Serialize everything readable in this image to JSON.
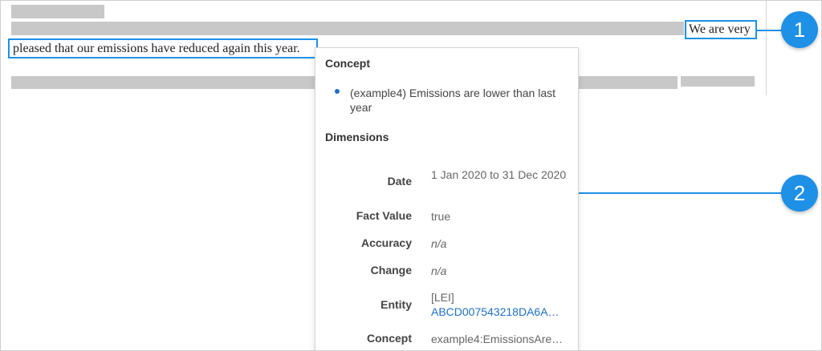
{
  "document": {
    "line1_text": "We are very",
    "line2_text": "pleased that our emissions have reduced again this year."
  },
  "callouts": {
    "one": "1",
    "two": "2"
  },
  "popup": {
    "concept_heading": "Concept",
    "concept_item": "(example4) Emissions are lower than last year",
    "dimensions_heading": "Dimensions",
    "rows": [
      {
        "label": "Date",
        "value": "1 Jan 2020 to 31 Dec 2020"
      },
      {
        "label": "Fact Value",
        "value": "true"
      },
      {
        "label": "Accuracy",
        "value": "n/a"
      },
      {
        "label": "Change",
        "value": "n/a"
      },
      {
        "label": "Entity",
        "value_prefix": "[LEI]",
        "value_link": "ABCD007543218DA6A…"
      },
      {
        "label": "Concept",
        "value": "example4:EmissionsAre…"
      }
    ]
  },
  "colors": {
    "accent": "#1e90e6",
    "link": "#1e6fc7",
    "redaction": "#c8c8c8"
  }
}
